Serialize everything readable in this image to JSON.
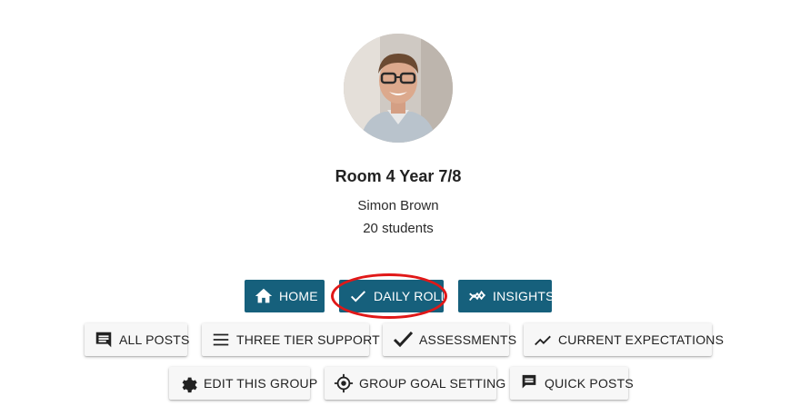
{
  "group": {
    "title": "Room 4 Year 7/8",
    "teacher": "Simon Brown",
    "students": "20 students"
  },
  "primary_nav": [
    {
      "label": "HOME",
      "icon": "home-icon"
    },
    {
      "label": "DAILY ROLL",
      "icon": "check-icon"
    },
    {
      "label": "INSIGHTS",
      "icon": "insights-icon"
    }
  ],
  "secondary_nav_row1": [
    {
      "label": "ALL POSTS",
      "icon": "comment-icon"
    },
    {
      "label": "THREE TIER SUPPORT",
      "icon": "menu-icon"
    },
    {
      "label": "ASSESSMENTS",
      "icon": "check-icon"
    },
    {
      "label": "CURRENT EXPECTATIONS",
      "icon": "trending-icon"
    }
  ],
  "secondary_nav_row2": [
    {
      "label": "EDIT THIS GROUP",
      "icon": "gear-icon"
    },
    {
      "label": "GROUP GOAL SETTING",
      "icon": "target-icon"
    },
    {
      "label": "QUICK POSTS",
      "icon": "chat-icon"
    }
  ],
  "colors": {
    "primary": "#16607c",
    "highlight": "#e01818"
  }
}
